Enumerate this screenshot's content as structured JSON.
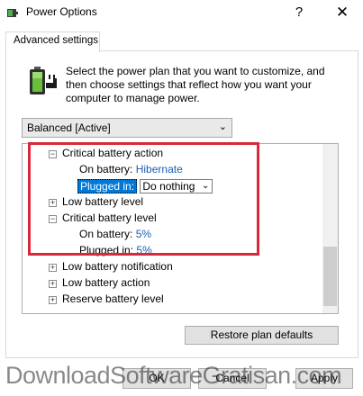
{
  "window": {
    "title": "Power Options",
    "help_label": "?",
    "close_label": "✕"
  },
  "tabs": [
    {
      "label": "Advanced settings",
      "active": true
    }
  ],
  "description": "Select the power plan that you want to customize, and then choose settings that reflect how you want your computer to manage power.",
  "plan_select": {
    "value": "Balanced [Active]",
    "arrow": "⌄"
  },
  "tree": {
    "critical_battery_action": {
      "toggle": "−",
      "label": "Critical battery action",
      "on_battery_label": "On battery:",
      "on_battery_value": "Hibernate",
      "plugged_in_label": "Plugged in:",
      "plugged_in_value": "Do nothing",
      "plugged_in_arrow": "⌄"
    },
    "low_battery_level": {
      "toggle": "+",
      "label": "Low battery level"
    },
    "critical_battery_level": {
      "toggle": "−",
      "label": "Critical battery level",
      "on_battery_label": "On battery:",
      "on_battery_value": "5%",
      "plugged_in_label": "Plugged in:",
      "plugged_in_value": "5%"
    },
    "low_battery_notification": {
      "toggle": "+",
      "label": "Low battery notification"
    },
    "low_battery_action": {
      "toggle": "+",
      "label": "Low battery action"
    },
    "reserve_battery_level": {
      "toggle": "+",
      "label": "Reserve battery level"
    }
  },
  "buttons": {
    "restore": "Restore plan defaults",
    "ok": "OK",
    "cancel": "Cancel",
    "apply": "Apply"
  },
  "watermark": "DownloadSoftwareGratisan.com",
  "colors": {
    "highlight": "#0078d7",
    "link_value": "#1a5fb4",
    "annotation_box": "#d8283a"
  }
}
